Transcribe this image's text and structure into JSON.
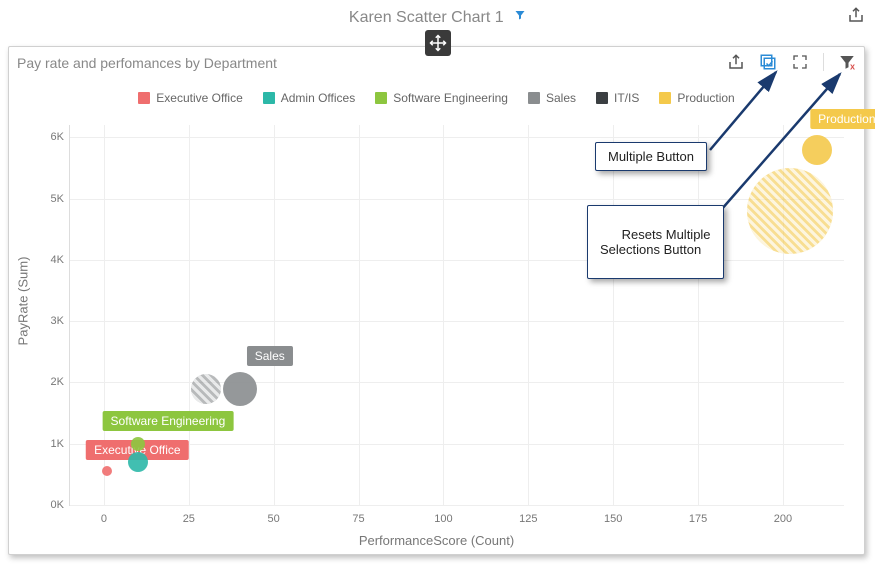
{
  "title": "Karen Scatter Chart 1",
  "panel_title": "Pay rate and perfomances by Department",
  "legend": [
    {
      "label": "Executive Office",
      "color": "#ef6e6e"
    },
    {
      "label": "Admin Offices",
      "color": "#2cb8a8"
    },
    {
      "label": "Software Engineering",
      "color": "#8dc63f"
    },
    {
      "label": "Sales",
      "color": "#8a8d8f"
    },
    {
      "label": "IT/IS",
      "color": "#3b3f42"
    },
    {
      "label": "Production",
      "color": "#f4c94b"
    }
  ],
  "callouts": {
    "multiple": "Multiple Button",
    "reset": "Resets Multiple\nSelections Button"
  },
  "chart_data": {
    "type": "scatter",
    "title": "Pay rate and perfomances by Department",
    "xlabel": "PerformanceScore (Count)",
    "ylabel": "PayRate (Sum)",
    "xlim": [
      -10,
      218
    ],
    "ylim": [
      0,
      6200
    ],
    "xticks": [
      0,
      25,
      50,
      75,
      100,
      125,
      150,
      175,
      200
    ],
    "yticks": [
      0,
      1000,
      2000,
      3000,
      4000,
      5000,
      6000
    ],
    "ytick_labels": [
      "0K",
      "1K",
      "2K",
      "3K",
      "4K",
      "5K",
      "6K"
    ],
    "series": [
      {
        "name": "Executive Office",
        "color": "#ef6e6e",
        "x": 1,
        "y": 550,
        "size": 10,
        "label_shown": true
      },
      {
        "name": "Admin Offices",
        "color": "#2cb8a8",
        "x": 10,
        "y": 700,
        "size": 20,
        "label_shown": false
      },
      {
        "name": "Software Engineering",
        "color": "#8dc63f",
        "x": 10,
        "y": 1000,
        "size": 14,
        "label_shown": true
      },
      {
        "name": "Sales (striped)",
        "color": "#8a8d8f",
        "x": 30,
        "y": 1900,
        "size": 30,
        "striped": true,
        "label_shown": false
      },
      {
        "name": "Sales",
        "color": "#8a8d8f",
        "x": 40,
        "y": 1900,
        "size": 34,
        "label_shown": true
      },
      {
        "name": "Production (striped)",
        "color": "#f4c94b",
        "x": 202,
        "y": 4800,
        "size": 86,
        "striped": true,
        "label_shown": false
      },
      {
        "name": "Production",
        "color": "#f4c94b",
        "x": 210,
        "y": 5800,
        "size": 30,
        "label_shown": true
      }
    ]
  }
}
